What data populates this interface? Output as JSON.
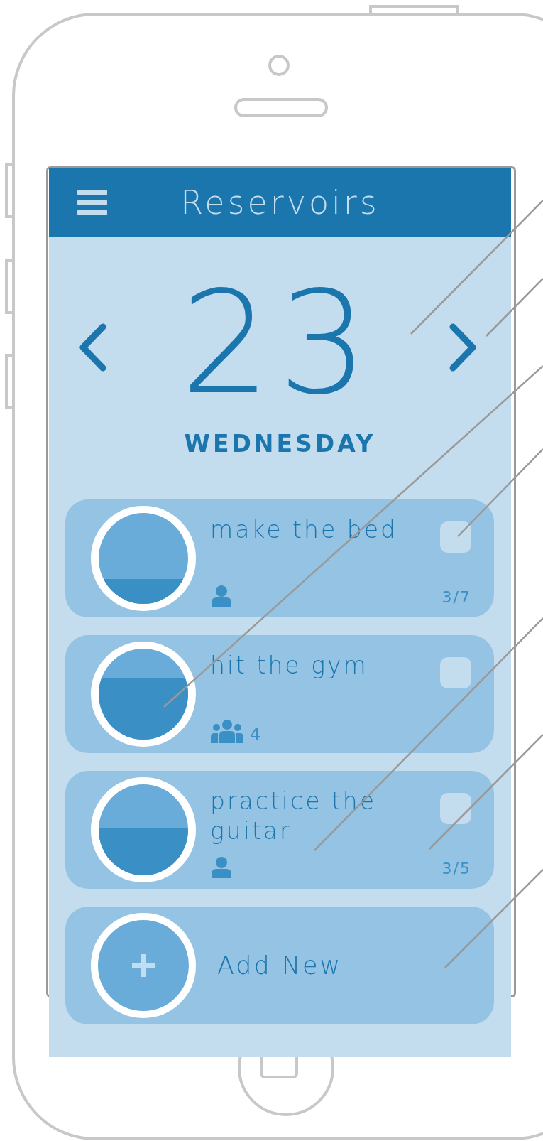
{
  "app_bar": {
    "title": "Reservoirs"
  },
  "date": {
    "day": "23",
    "weekday": "WEDNESDAY"
  },
  "tasks": [
    {
      "title": "make the bed",
      "kind": "single",
      "level": 0.27,
      "checked": false,
      "progress": "3/7"
    },
    {
      "title": "hit the gym",
      "kind": "group",
      "count": "4",
      "level": 0.68,
      "checked": false
    },
    {
      "title": "practice the guitar",
      "kind": "single",
      "level": 0.52,
      "checked": false,
      "progress": "3/5"
    }
  ],
  "add_new": {
    "label": "Add New"
  }
}
